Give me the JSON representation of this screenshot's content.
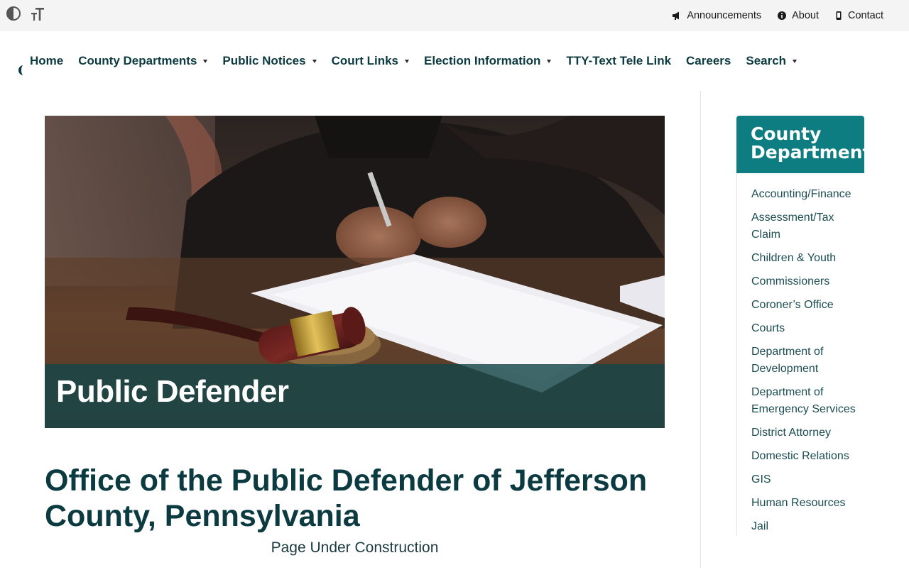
{
  "utility_bar": {
    "contrast_icon": "contrast-icon",
    "text_size_icon": "text-size-icon",
    "links": [
      {
        "label": "Announcements",
        "icon": "megaphone-icon"
      },
      {
        "label": "About",
        "icon": "info-icon"
      },
      {
        "label": "Contact",
        "icon": "phone-icon"
      }
    ]
  },
  "nav": {
    "items": [
      {
        "label": "Home",
        "dropdown": false
      },
      {
        "label": "County Departments",
        "dropdown": true
      },
      {
        "label": "Public Notices",
        "dropdown": true
      },
      {
        "label": "Court Links",
        "dropdown": true
      },
      {
        "label": "Election Information",
        "dropdown": true
      },
      {
        "label": "TTY-Text Tele Link",
        "dropdown": false
      },
      {
        "label": "Careers",
        "dropdown": false
      },
      {
        "label": "Search",
        "dropdown": true
      }
    ]
  },
  "hero": {
    "title": "Public Defender",
    "image": "judge-writing-gavel-photo"
  },
  "main": {
    "title": "Office of the Public Defender of Jefferson County, Pennsylvania",
    "subtitle": "Page Under Construction"
  },
  "sidebar": {
    "title_line1": "County",
    "title_line2": "Departments",
    "items": [
      "Accounting/Finance",
      "Assessment/Tax Claim",
      "Children & Youth",
      "Commissioners",
      "Coroner’s Office",
      "Courts",
      "Department of Development",
      "Department of Emergency Services",
      "District Attorney",
      "Domestic Relations",
      "GIS",
      "Human Resources",
      "Jail"
    ]
  },
  "colors": {
    "brand_dark": "#0b3a40",
    "sidebar_header": "#0e7d82",
    "hero_caption": "#164648",
    "topbar_bg": "#f4f4f4"
  }
}
